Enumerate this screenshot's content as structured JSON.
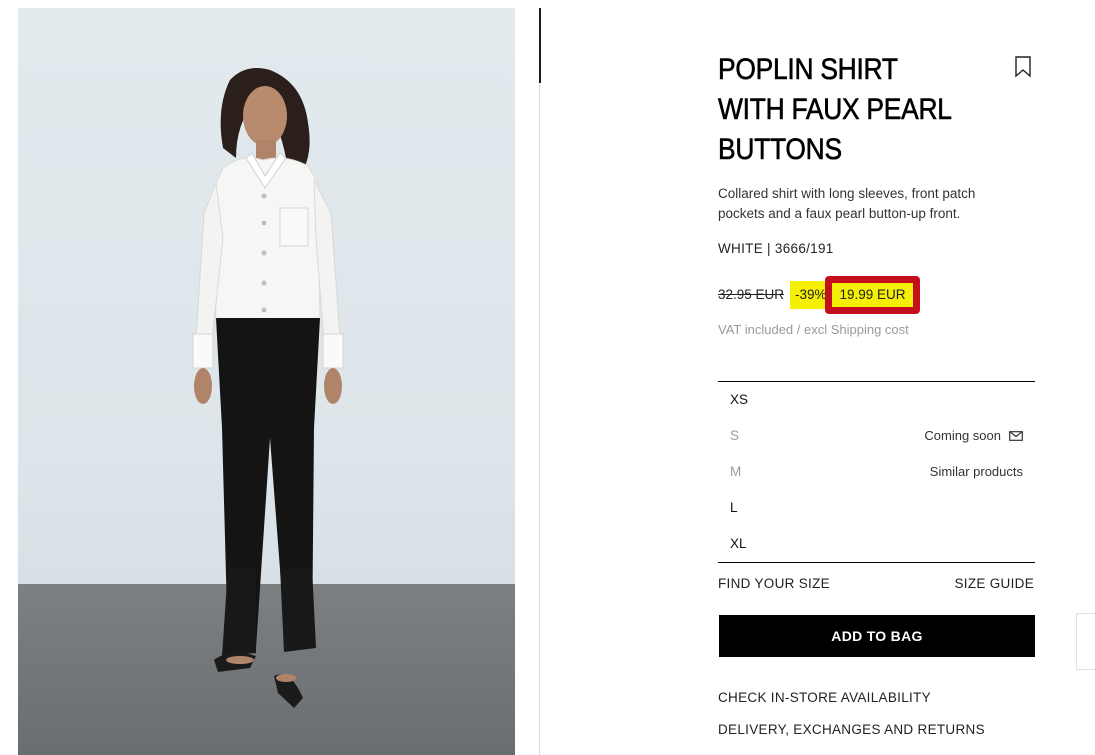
{
  "product": {
    "title": "POPLIN SHIRT WITH FAUX PEARL BUTTONS",
    "description": "Collared shirt with long sleeves, front patch pockets and a faux pearl button-up front.",
    "reference": "WHITE | 3666/191",
    "old_price": "32.95 EUR",
    "discount": "-39%",
    "price": "19.99 EUR",
    "vat_note": "VAT included / excl Shipping cost"
  },
  "sizes": [
    {
      "label": "XS",
      "note": "",
      "available": true
    },
    {
      "label": "S",
      "note": "Coming soon",
      "available": false
    },
    {
      "label": "M",
      "note": "Similar products",
      "available": false
    },
    {
      "label": "L",
      "note": "",
      "available": true
    },
    {
      "label": "XL",
      "note": "",
      "available": true
    }
  ],
  "actions": {
    "find_size": "FIND YOUR SIZE",
    "size_guide": "SIZE GUIDE",
    "add_to_bag": "ADD TO BAG",
    "check_store": "CHECK IN-STORE AVAILABILITY",
    "delivery": "DELIVERY, EXCHANGES AND RETURNS"
  },
  "icons": {
    "bookmark": "bookmark-icon",
    "mail": "mail-icon"
  },
  "colors": {
    "highlight": "#f5ef05",
    "price_box_border": "#c4101c",
    "button": "#000000"
  }
}
